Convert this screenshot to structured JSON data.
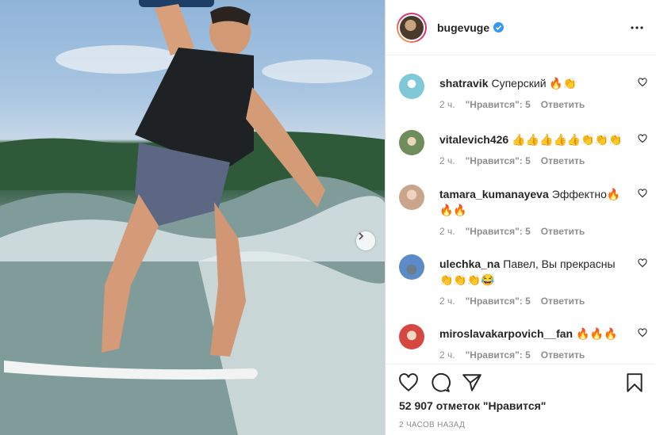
{
  "post": {
    "username": "bugevuge",
    "likes_text": "52 907 отметок \"Нравится\"",
    "time_text": "2 ЧАСОВ НАЗАД"
  },
  "comments": [
    {
      "username": "shatravik",
      "text": "Суперский 🔥👏",
      "time": "2 ч.",
      "likes": "\"Нравится\": 5",
      "reply": "Ответить"
    },
    {
      "username": "vitalevich426",
      "text": "👍👍👍👍👍👏👏👏",
      "time": "2 ч.",
      "likes": "\"Нравится\": 5",
      "reply": "Ответить"
    },
    {
      "username": "tamara_kumanayeva",
      "text": "Эффектно🔥🔥🔥",
      "time": "2 ч.",
      "likes": "\"Нравится\": 5",
      "reply": "Ответить"
    },
    {
      "username": "ulechka_na",
      "text": "Павел, Вы прекрасны 👏👏👏😂",
      "time": "2 ч.",
      "likes": "\"Нравится\": 5",
      "reply": "Ответить"
    },
    {
      "username": "miroslavakarpovich__fan",
      "text": "🔥🔥🔥",
      "time": "2 ч.",
      "likes": "\"Нравится\": 5",
      "reply": "Ответить"
    }
  ],
  "icons": {
    "verified": "verified-badge-icon",
    "more": "more-options-icon",
    "next": "chevron-right-icon",
    "like": "heart-icon",
    "comment": "comment-icon",
    "share": "paper-plane-icon",
    "save": "bookmark-icon"
  },
  "colors": {
    "verified": "#3897f0",
    "text": "#262626",
    "muted": "#8e8e8e",
    "border": "#dbdbdb"
  }
}
